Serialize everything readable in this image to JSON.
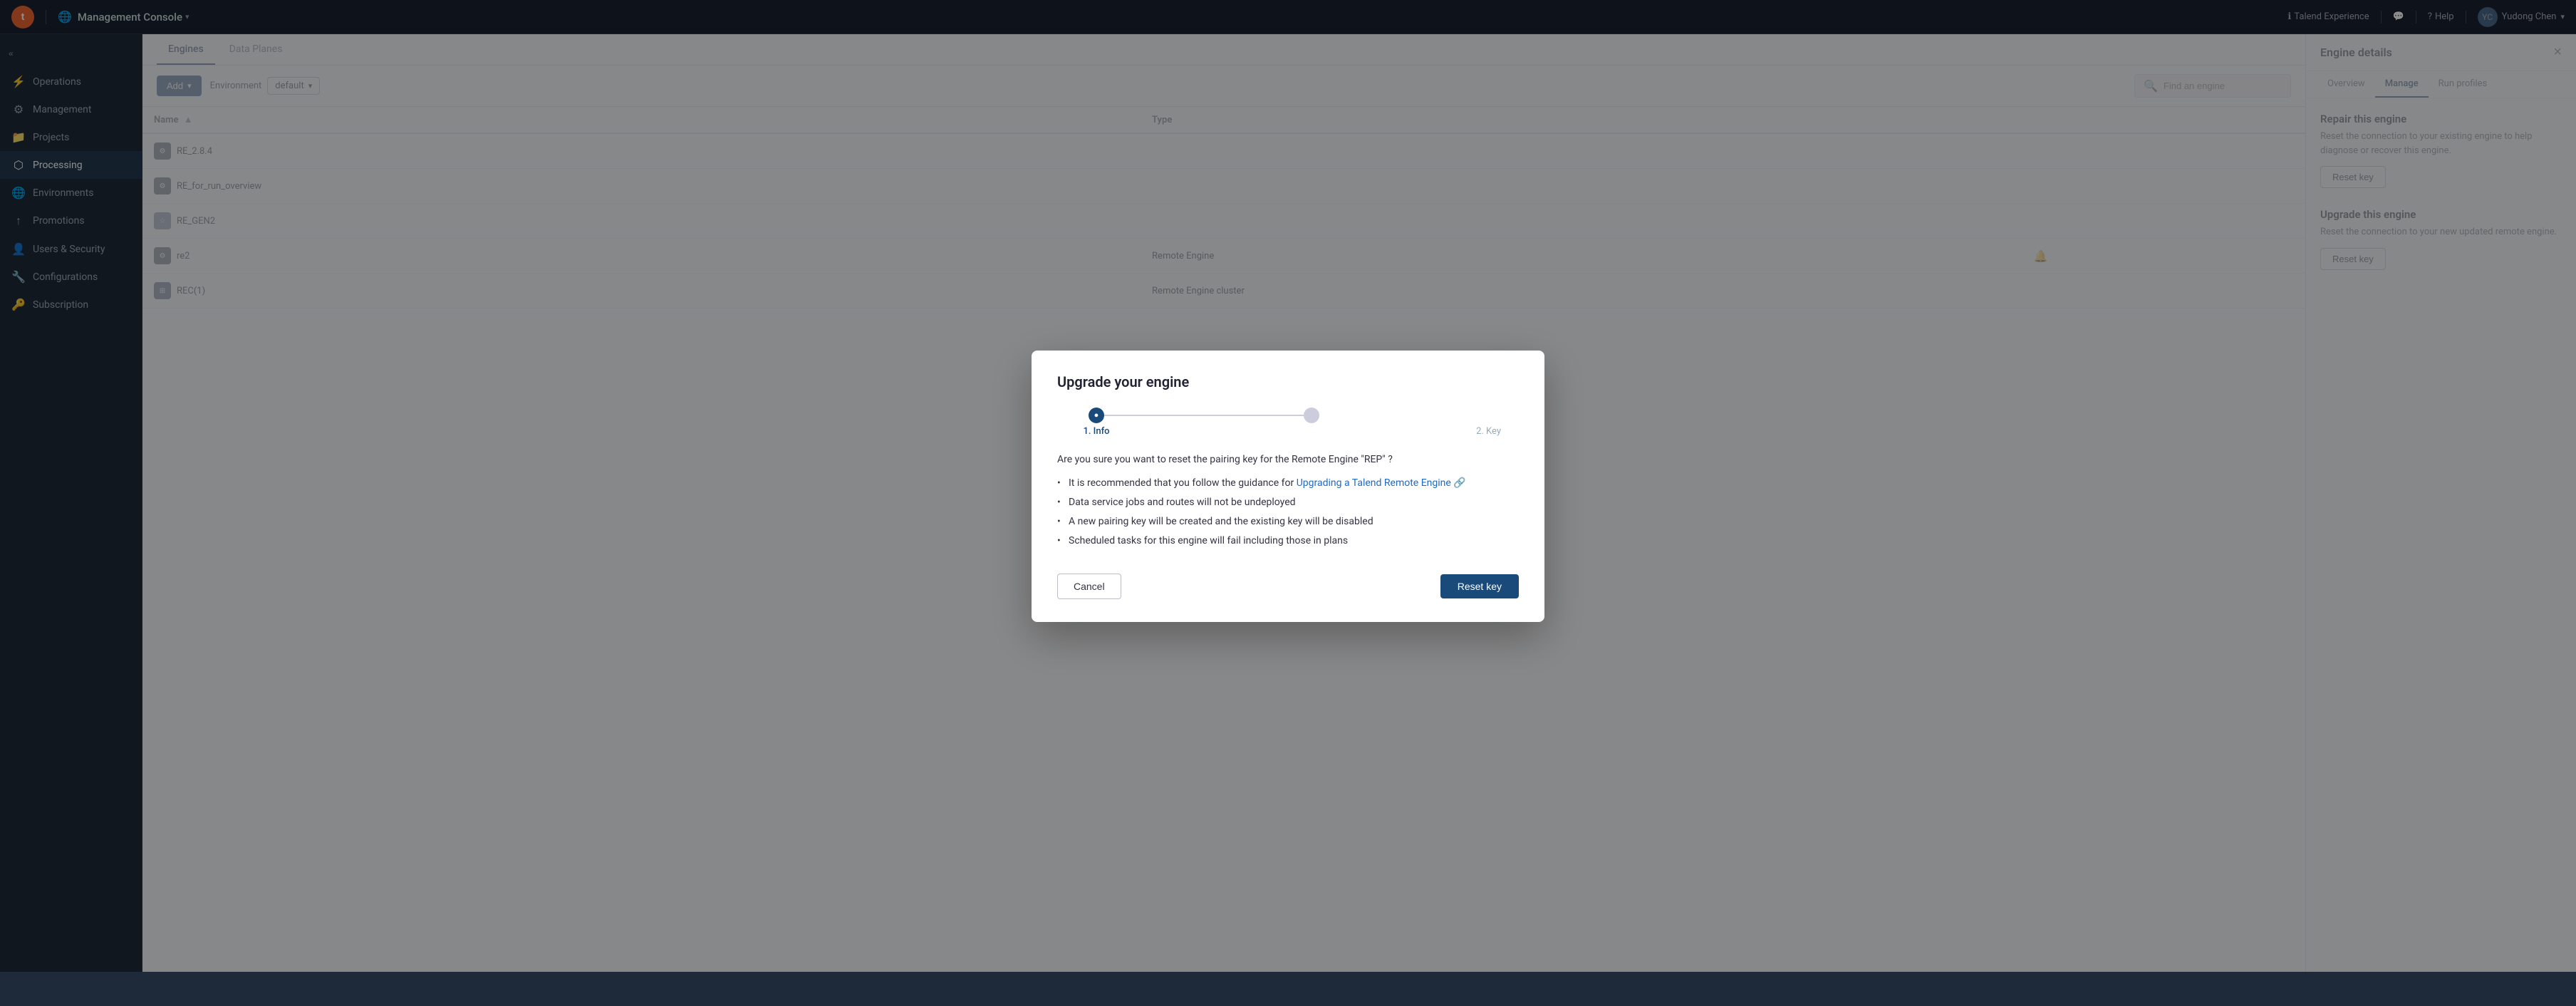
{
  "app": {
    "logo_letter": "t",
    "title": "Management Console",
    "globe_label": "Talend Experience",
    "help_label": "Help",
    "user_label": "Yudong Chen",
    "collapse_btn": "«"
  },
  "sidebar": {
    "items": [
      {
        "id": "operations",
        "label": "Operations",
        "icon": "⚡"
      },
      {
        "id": "management",
        "label": "Management",
        "icon": "⚙"
      },
      {
        "id": "projects",
        "label": "Projects",
        "icon": "📁"
      },
      {
        "id": "processing",
        "label": "Processing",
        "icon": "⬡",
        "active": true
      },
      {
        "id": "environments",
        "label": "Environments",
        "icon": "🌐"
      },
      {
        "id": "promotions",
        "label": "Promotions",
        "icon": "↑"
      },
      {
        "id": "users-security",
        "label": "Users & Security",
        "icon": "👤"
      },
      {
        "id": "configurations",
        "label": "Configurations",
        "icon": "🔧"
      },
      {
        "id": "subscription",
        "label": "Subscription",
        "icon": "🔑"
      }
    ]
  },
  "tabs": [
    {
      "id": "engines",
      "label": "Engines",
      "active": true
    },
    {
      "id": "data-planes",
      "label": "Data Planes",
      "active": false
    }
  ],
  "toolbar": {
    "add_label": "Add",
    "env_label": "Environment",
    "env_value": "default",
    "search_placeholder": "Find an engine"
  },
  "table": {
    "columns": [
      {
        "id": "name",
        "label": "Name",
        "sortable": true
      },
      {
        "id": "type",
        "label": "Type"
      },
      {
        "id": "actions",
        "label": ""
      }
    ],
    "rows": [
      {
        "id": "re-284",
        "name": "RE_2.8.4",
        "type": "",
        "icon_type": "gear"
      },
      {
        "id": "re-run",
        "name": "RE_for_run_overview",
        "type": "",
        "icon_type": "gear"
      },
      {
        "id": "re-gen2",
        "name": "RE_GEN2",
        "type": "",
        "icon_type": "star"
      },
      {
        "id": "re2",
        "name": "re2",
        "type": "Remote Engine",
        "icon_type": "gear",
        "bell": true
      },
      {
        "id": "rec1",
        "name": "REC(1)",
        "type": "Remote Engine cluster",
        "icon_type": "grid"
      }
    ]
  },
  "right_panel": {
    "title": "Engine details",
    "tabs": [
      {
        "id": "overview",
        "label": "Overview"
      },
      {
        "id": "manage",
        "label": "Manage",
        "active": true
      },
      {
        "id": "run-profiles",
        "label": "Run profiles"
      }
    ],
    "sections": [
      {
        "id": "repair",
        "title": "Repair this engine",
        "description": "Reset the connection to your existing engine to help diagnose or recover this engine.",
        "button_label": "Reset key"
      },
      {
        "id": "upgrade",
        "title": "Upgrade this engine",
        "description": "Reset the connection to your new updated remote engine.",
        "button_label": "Reset key"
      }
    ]
  },
  "modal": {
    "title": "Upgrade your engine",
    "steps": [
      {
        "id": "info",
        "label": "1. Info",
        "active": true
      },
      {
        "id": "key",
        "label": "2. Key",
        "active": false
      }
    ],
    "question": "Are you sure you want to reset the pairing key for the Remote Engine \"REP\" ?",
    "bullet_points": [
      {
        "text": "It is recommended that you follow the guidance for ",
        "link_text": "Upgrading a Talend Remote Engine",
        "link_url": "#"
      },
      {
        "text": "Data service jobs and routes will not be undeployed"
      },
      {
        "text": "A new pairing key will be created and the existing key will be disabled"
      },
      {
        "text": "Scheduled tasks for this engine will fail including those in plans"
      }
    ],
    "cancel_label": "Cancel",
    "confirm_label": "Reset key"
  }
}
